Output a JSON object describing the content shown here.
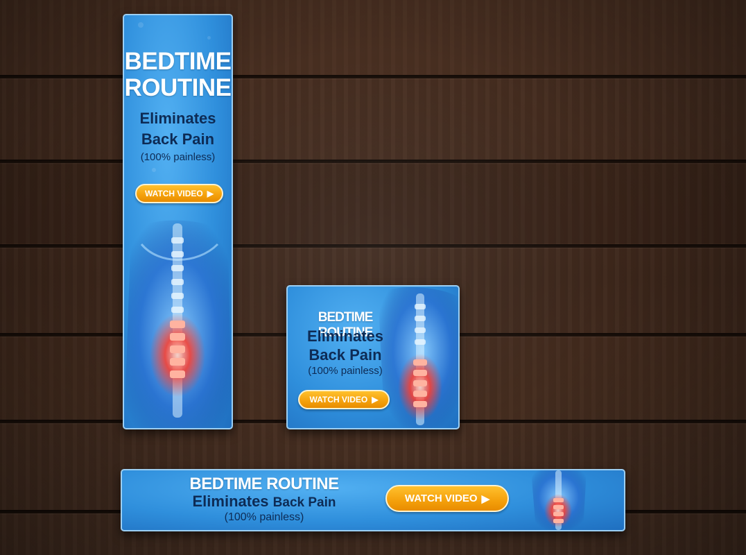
{
  "banner_tall": {
    "title": "BEDTIME ROUTINE",
    "subtitle": "Eliminates Back Pain",
    "note": "(100% painless)",
    "cta_label": "WATCH VIDEO"
  },
  "banner_square": {
    "title": "BEDTIME ROUTINE",
    "subtitle": "Eliminates Back Pain",
    "note": "(100% painless)",
    "cta_label": "WATCH VIDEO"
  },
  "banner_wide": {
    "title": "BEDTIME ROUTINE",
    "subtitle_part1": "Eliminates",
    "subtitle_part2": "Back Pain",
    "note": "(100% painless)",
    "cta_label": "WATCH VIDEO"
  },
  "icons": {
    "play": "play-triangle-icon"
  },
  "colors": {
    "banner_blue": "#2f8fdc",
    "headline_white": "#ffffff",
    "text_navy": "#0d2b55",
    "cta_orange": "#f4a00b",
    "spine_red": "#ff3b2a",
    "wood_brown": "#3d271b"
  }
}
